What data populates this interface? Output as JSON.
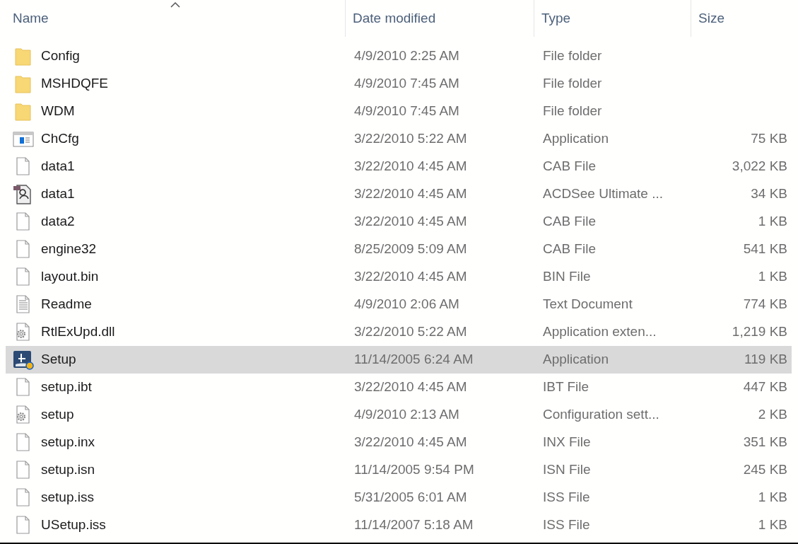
{
  "columns": [
    {
      "label": "Name",
      "sorted": true
    },
    {
      "label": "Date modified",
      "sorted": false
    },
    {
      "label": "Type",
      "sorted": false
    },
    {
      "label": "Size",
      "sorted": false
    }
  ],
  "rows": [
    {
      "kind": "folder",
      "name": "Config",
      "date": "4/9/2010 2:25 AM",
      "type": "File folder",
      "selected": false
    },
    {
      "kind": "folder",
      "name": "MSHDQFE",
      "date": "4/9/2010 7:45 AM",
      "type": "File folder",
      "selected": false
    },
    {
      "kind": "folder",
      "name": "WDM",
      "date": "4/9/2010 7:45 AM",
      "type": "File folder",
      "selected": false
    },
    {
      "kind": "app",
      "name": "ChCfg",
      "date": "3/22/2010 5:22 AM",
      "type": "Application",
      "size": "75 KB",
      "selected": false
    },
    {
      "kind": "file",
      "name": "data1",
      "date": "3/22/2010 4:45 AM",
      "type": "CAB File",
      "size": "3,022 KB",
      "selected": false
    },
    {
      "kind": "image",
      "name": "data1",
      "date": "3/22/2010 4:45 AM",
      "type": "ACDSee Ultimate ...",
      "size": "34 KB",
      "selected": false
    },
    {
      "kind": "file",
      "name": "data2",
      "date": "3/22/2010 4:45 AM",
      "type": "CAB File",
      "size": "1 KB",
      "selected": false
    },
    {
      "kind": "file",
      "name": "engine32",
      "date": "8/25/2009 5:09 AM",
      "type": "CAB File",
      "size": "541 KB",
      "selected": false
    },
    {
      "kind": "file",
      "name": "layout.bin",
      "date": "3/22/2010 4:45 AM",
      "type": "BIN File",
      "size": "1 KB",
      "selected": false
    },
    {
      "kind": "text",
      "name": "Readme",
      "date": "4/9/2010 2:06 AM",
      "type": "Text Document",
      "size": "774 KB",
      "selected": false
    },
    {
      "kind": "gear",
      "name": "RtlExUpd.dll",
      "date": "3/22/2010 5:22 AM",
      "type": "Application exten...",
      "size": "1,219 KB",
      "selected": false
    },
    {
      "kind": "setup",
      "name": "Setup",
      "date": "11/14/2005 6:24 AM",
      "type": "Application",
      "size": "119 KB",
      "selected": true
    },
    {
      "kind": "file",
      "name": "setup.ibt",
      "date": "3/22/2010 4:45 AM",
      "type": "IBT File",
      "size": "447 KB",
      "selected": false
    },
    {
      "kind": "gear",
      "name": "setup",
      "date": "4/9/2010 2:13 AM",
      "type": "Configuration sett...",
      "size": "2 KB",
      "selected": false
    },
    {
      "kind": "file",
      "name": "setup.inx",
      "date": "3/22/2010 4:45 AM",
      "type": "INX File",
      "size": "351 KB",
      "selected": false
    },
    {
      "kind": "file",
      "name": "setup.isn",
      "date": "11/14/2005 9:54 PM",
      "type": "ISN File",
      "size": "245 KB",
      "selected": false
    },
    {
      "kind": "file",
      "name": "setup.iss",
      "date": "5/31/2005 6:01 AM",
      "type": "ISS File",
      "size": "1 KB",
      "selected": false
    },
    {
      "kind": "file",
      "name": "USetup.iss",
      "date": "11/14/2007 5:18 AM",
      "type": "ISS File",
      "size": "1 KB",
      "selected": false
    }
  ]
}
